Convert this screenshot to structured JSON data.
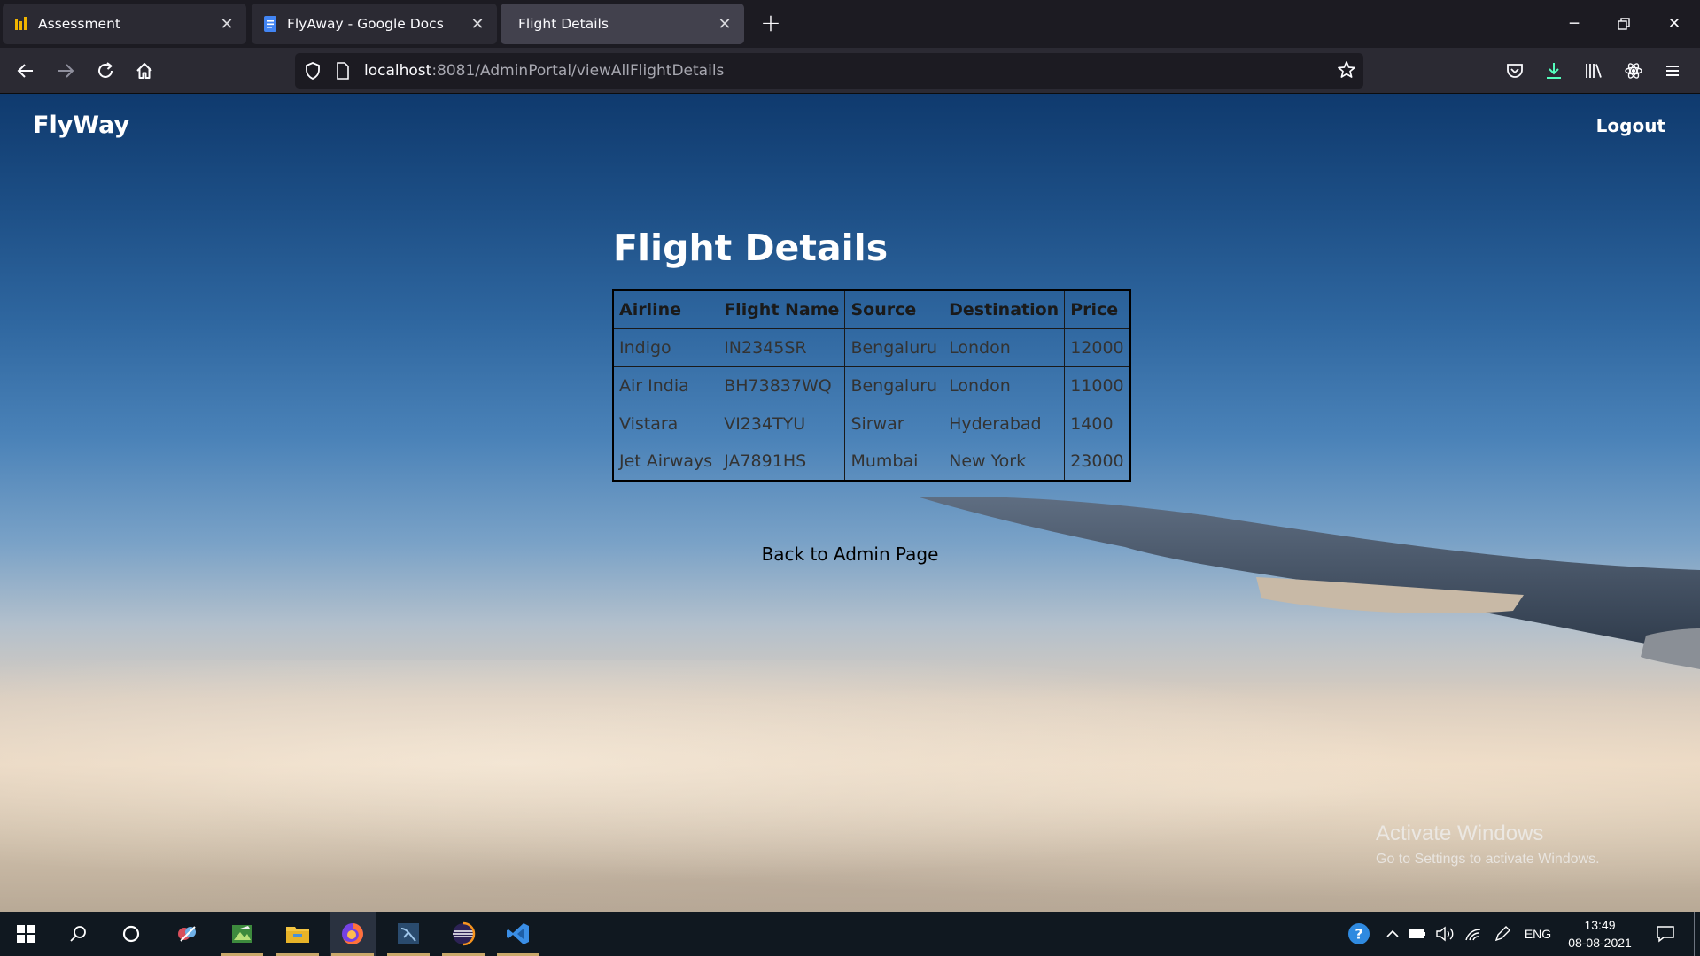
{
  "browser": {
    "tabs": [
      {
        "title": "Assessment",
        "state": "inactive",
        "icon": "assessment-icon"
      },
      {
        "title": "FlyAway - Google Docs",
        "state": "inactive",
        "icon": "google-docs-icon"
      },
      {
        "title": "Flight Details",
        "state": "active",
        "icon": "none"
      }
    ],
    "url_host": "localhost",
    "url_rest": ":8081/AdminPortal/viewAllFlightDetails"
  },
  "site": {
    "brand": "FlyWay",
    "logout": "Logout",
    "heading": "Flight Details",
    "back_link": "Back to Admin Page"
  },
  "table": {
    "headers": [
      "Airline",
      "Flight Name",
      "Source",
      "Destination",
      "Price"
    ],
    "rows": [
      [
        "Indigo",
        "IN2345SR",
        "Bengaluru",
        "London",
        "12000"
      ],
      [
        "Air India",
        "BH73837WQ",
        "Bengaluru",
        "London",
        "11000"
      ],
      [
        "Vistara",
        "VI234TYU",
        "Sirwar",
        "Hyderabad",
        "1400"
      ],
      [
        "Jet Airways",
        "JA7891HS",
        "Mumbai",
        "New York",
        "23000"
      ]
    ]
  },
  "watermark": {
    "line1": "Activate Windows",
    "line2": "Go to Settings to activate Windows."
  },
  "taskbar": {
    "language": "ENG",
    "time": "13:49",
    "date": "08-08-2021"
  },
  "colors": {
    "tab_strip": "#1c1b22",
    "active_tab": "#42414d",
    "toolbar": "#2b2a33",
    "taskbar": "#101820",
    "download_accent": "#54ffbd"
  }
}
